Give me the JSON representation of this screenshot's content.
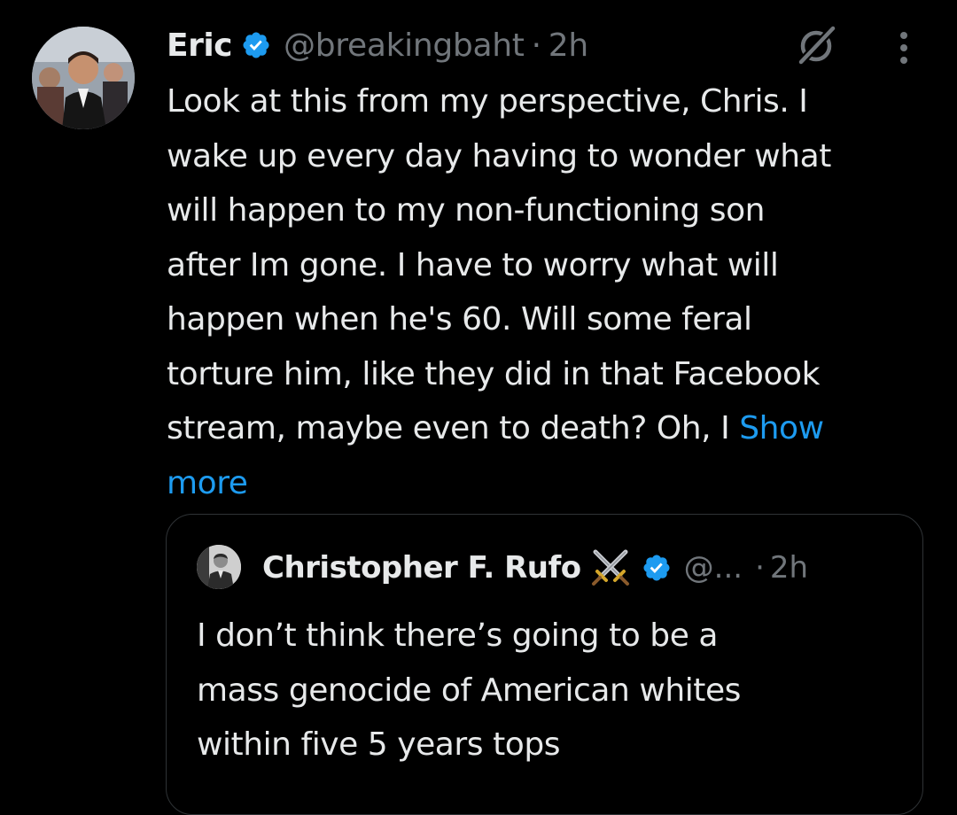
{
  "tweet": {
    "author": {
      "name": "Eric",
      "handle": "@breakingbaht",
      "verified": true
    },
    "separator": "·",
    "time": "2h",
    "body_lines": [
      "Look at this from my perspective, Chris. I",
      "wake up every day having to wonder what",
      "will happen to my non-functioning son",
      "after Im gone. I have to worry what will",
      "happen when he's 60. Will some feral",
      "torture him, like they did in that Facebook",
      "stream, maybe even to death? Oh, I "
    ],
    "show_more_part1": "Show",
    "show_more_part2": "more",
    "icons": {
      "grok": "grok-icon",
      "more": "more-vertical-icon",
      "verified": "verified-badge-icon"
    }
  },
  "quote": {
    "author": {
      "name": "Christopher F. Rufo",
      "handle": "@...",
      "verified": true,
      "emoji": "crossed-swords-icon"
    },
    "separator": "·",
    "time": "2h",
    "body_lines": [
      "I don’t think there’s going to be a",
      "mass genocide of American whites",
      "within five 5 years tops"
    ]
  },
  "colors": {
    "background": "#000000",
    "primary_text": "#e7e9ea",
    "secondary_text": "#71767b",
    "accent": "#1d9bf0",
    "border": "#2f3336"
  }
}
